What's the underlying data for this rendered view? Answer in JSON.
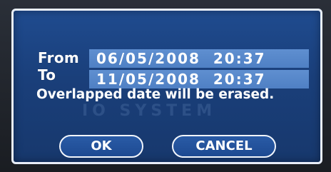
{
  "dialog": {
    "from_label": "From",
    "from_value": "06/05/2008  20:37",
    "to_label": "To",
    "to_value": "11/05/2008  20:37",
    "message": "Overlapped date will be erased.",
    "watermark": "IO SYSTEM",
    "ok_label": "OK",
    "cancel_label": "CANCEL"
  },
  "colors": {
    "dialog_background": "#1a3f7a",
    "field_background": "#5587c9",
    "text": "#ffffff",
    "border": "#e8eef8"
  }
}
